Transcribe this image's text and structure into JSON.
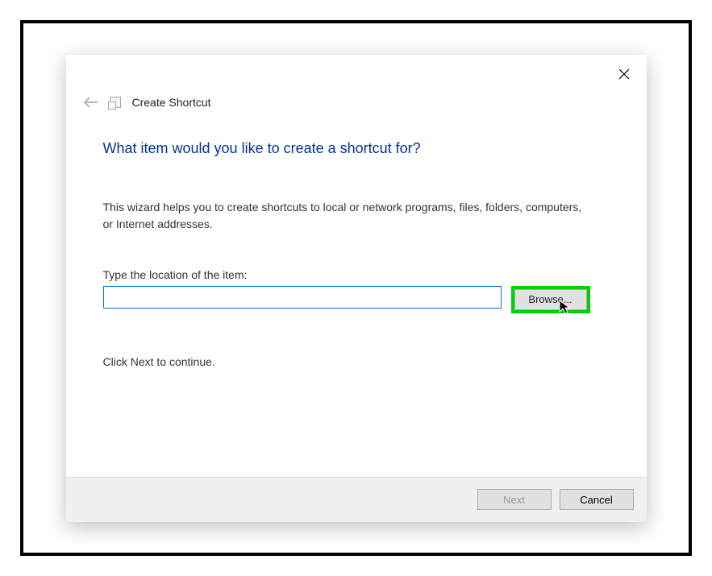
{
  "header": {
    "title": "Create Shortcut"
  },
  "main": {
    "heading": "What item would you like to create a shortcut for?",
    "description": "This wizard helps you to create shortcuts to local or network programs, files, folders, computers, or Internet addresses.",
    "input_label": "Type the location of the item:",
    "input_value": "",
    "browse_label": "Browse...",
    "continue_text": "Click Next to continue."
  },
  "footer": {
    "next_label": "Next",
    "cancel_label": "Cancel"
  },
  "highlight_color": "#00d000"
}
